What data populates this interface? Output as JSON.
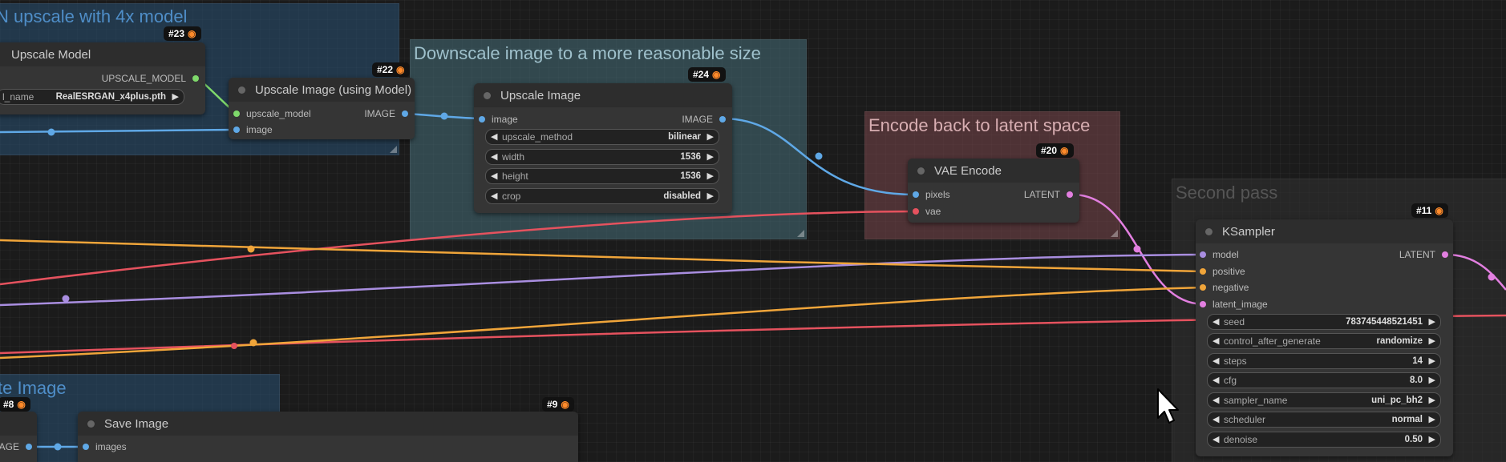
{
  "groups": {
    "upscale4x": {
      "title": "N upscale with 4x model"
    },
    "downscale": {
      "title": "Downscale image to a more reasonable size"
    },
    "encode": {
      "title": "Encode back to latent space"
    },
    "second_pass": {
      "title": "Second pass"
    },
    "save_group": {
      "title": "te Image"
    }
  },
  "nodes": {
    "upscale_model": {
      "badge": "#23",
      "title": "Upscale Model",
      "output": "UPSCALE_MODEL",
      "widget_label": "l_name",
      "widget_value": "RealESRGAN_x4plus.pth"
    },
    "upscale_image_model": {
      "badge": "#22",
      "title": "Upscale Image (using Model)",
      "inputs": [
        "upscale_model",
        "image"
      ],
      "output": "IMAGE"
    },
    "upscale_image": {
      "badge": "#24",
      "title": "Upscale Image",
      "input": "image",
      "output": "IMAGE",
      "widgets": [
        {
          "label": "upscale_method",
          "value": "bilinear"
        },
        {
          "label": "width",
          "value": "1536"
        },
        {
          "label": "height",
          "value": "1536"
        },
        {
          "label": "crop",
          "value": "disabled"
        }
      ]
    },
    "vae_encode": {
      "badge": "#20",
      "title": "VAE Encode",
      "inputs": [
        "pixels",
        "vae"
      ],
      "output": "LATENT"
    },
    "ksampler": {
      "badge": "#11",
      "title": "KSampler",
      "inputs": [
        "model",
        "positive",
        "negative",
        "latent_image"
      ],
      "output": "LATENT",
      "widgets": [
        {
          "label": "seed",
          "value": "783745448521451"
        },
        {
          "label": "control_after_generate",
          "value": "randomize"
        },
        {
          "label": "steps",
          "value": "14"
        },
        {
          "label": "cfg",
          "value": "8.0"
        },
        {
          "label": "sampler_name",
          "value": "uni_pc_bh2"
        },
        {
          "label": "scheduler",
          "value": "normal"
        },
        {
          "label": "denoise",
          "value": "0.50"
        }
      ]
    },
    "save_image": {
      "badge": "#9",
      "title": "Save Image",
      "input": "images"
    },
    "node8": {
      "badge": "#8",
      "output": "AGE"
    }
  },
  "colors": {
    "image_wire": "#5fa8e6",
    "latent_wire": "#e27fe0",
    "vae_wire": "#e5525e",
    "model_wire": "#a98ee0",
    "conditioning_wire": "#f0a53a",
    "upscale_model_wire": "#7fd96b"
  },
  "icons": {
    "badge_icon": "fox-icon",
    "widget_left": "arrow-left-icon",
    "widget_right": "arrow-right-icon",
    "cursor": "mouse-cursor-icon"
  }
}
